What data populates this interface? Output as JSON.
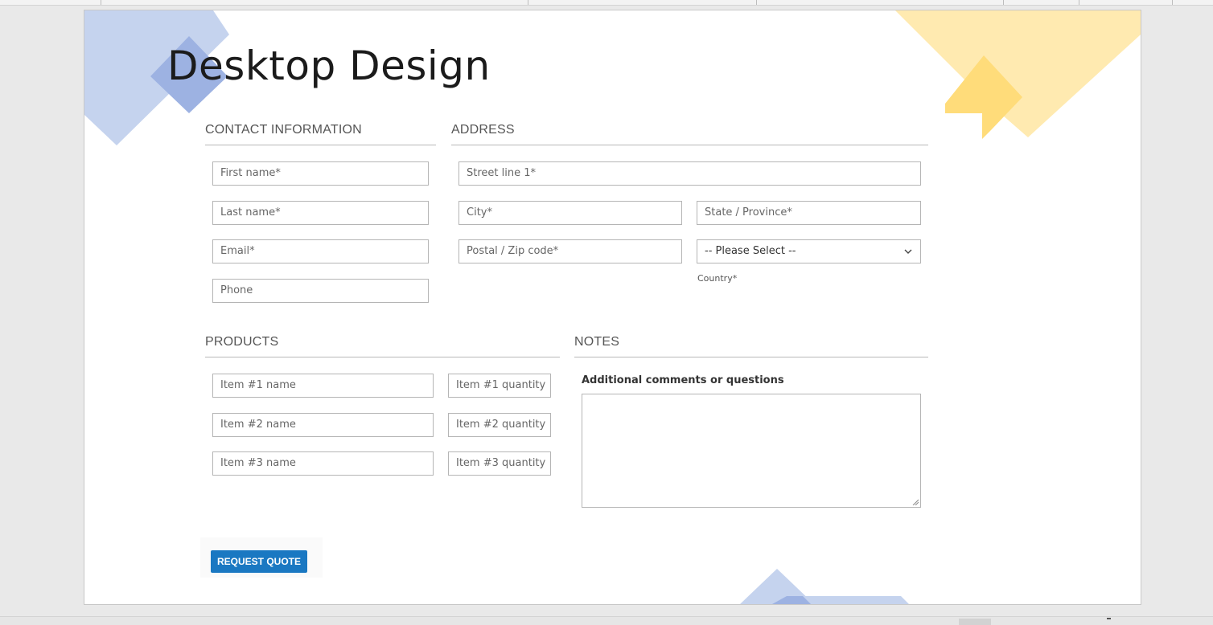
{
  "colors": {
    "accent_button": "#1a78c2",
    "deco_blue": "#c5d3ee",
    "deco_blue_dark": "#9db2e2",
    "deco_yellow": "#ffeab0",
    "deco_yellow_dark": "#ffdc7a"
  },
  "page": {
    "title": "Desktop Design"
  },
  "contact": {
    "heading": "CONTACT INFORMATION",
    "first_name": "First name*",
    "last_name": "Last name*",
    "email": "Email*",
    "phone": "Phone"
  },
  "address": {
    "heading": "ADDRESS",
    "street": "Street line 1*",
    "city": "City*",
    "state": "State / Province*",
    "postal": "Postal / Zip code*",
    "country_select": "-- Please Select --",
    "country_label": "Country*",
    "chevron_icon": "chevron-down-icon"
  },
  "products": {
    "heading": "PRODUCTS",
    "items": [
      {
        "name": "Item #1 name",
        "quantity": "Item #1 quantity"
      },
      {
        "name": "Item #2 name",
        "quantity": "Item #2 quantity"
      },
      {
        "name": "Item #3 name",
        "quantity": "Item #3 quantity"
      }
    ]
  },
  "notes": {
    "heading": "NOTES",
    "comments_label": "Additional comments or questions",
    "comments_value": ""
  },
  "actions": {
    "submit_label": "REQUEST QUOTE"
  }
}
